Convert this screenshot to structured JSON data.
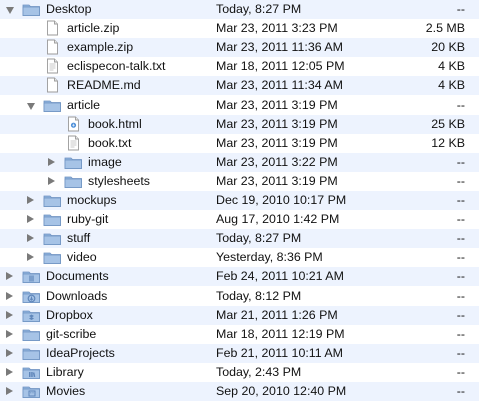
{
  "rows": [
    {
      "name": "Desktop",
      "date": "Today, 8:27 PM",
      "size": "--",
      "kind": "folder",
      "icon": "folder-icon",
      "level": 0,
      "disclosure": "open"
    },
    {
      "name": "article.zip",
      "date": "Mar 23, 2011 3:23 PM",
      "size": "2.5 MB",
      "kind": "file",
      "icon": "file-icon",
      "level": 1,
      "disclosure": "none"
    },
    {
      "name": "example.zip",
      "date": "Mar 23, 2011 11:36 AM",
      "size": "20 KB",
      "kind": "file",
      "icon": "file-icon",
      "level": 1,
      "disclosure": "none"
    },
    {
      "name": "eclispecon-talk.txt",
      "date": "Mar 18, 2011 12:05 PM",
      "size": "4 KB",
      "kind": "text",
      "icon": "text-file-icon",
      "level": 1,
      "disclosure": "none"
    },
    {
      "name": "README.md",
      "date": "Mar 23, 2011 11:34 AM",
      "size": "4 KB",
      "kind": "file",
      "icon": "file-icon",
      "level": 1,
      "disclosure": "none"
    },
    {
      "name": "article",
      "date": "Mar 23, 2011 3:19 PM",
      "size": "--",
      "kind": "folder",
      "icon": "folder-icon",
      "level": 1,
      "disclosure": "open"
    },
    {
      "name": "book.html",
      "date": "Mar 23, 2011 3:19 PM",
      "size": "25 KB",
      "kind": "html",
      "icon": "html-file-icon",
      "level": 2,
      "disclosure": "none"
    },
    {
      "name": "book.txt",
      "date": "Mar 23, 2011 3:19 PM",
      "size": "12 KB",
      "kind": "text",
      "icon": "text-file-icon",
      "level": 2,
      "disclosure": "none"
    },
    {
      "name": "image",
      "date": "Mar 23, 2011 3:22 PM",
      "size": "--",
      "kind": "folder",
      "icon": "folder-icon",
      "level": 2,
      "disclosure": "closed"
    },
    {
      "name": "stylesheets",
      "date": "Mar 23, 2011 3:19 PM",
      "size": "--",
      "kind": "folder",
      "icon": "folder-icon",
      "level": 2,
      "disclosure": "closed"
    },
    {
      "name": "mockups",
      "date": "Dec 19, 2010 10:17 PM",
      "size": "--",
      "kind": "folder",
      "icon": "folder-icon",
      "level": 1,
      "disclosure": "closed"
    },
    {
      "name": "ruby-git",
      "date": "Aug 17, 2010 1:42 PM",
      "size": "--",
      "kind": "folder",
      "icon": "folder-icon",
      "level": 1,
      "disclosure": "closed"
    },
    {
      "name": "stuff",
      "date": "Today, 8:27 PM",
      "size": "--",
      "kind": "folder",
      "icon": "folder-icon",
      "level": 1,
      "disclosure": "closed"
    },
    {
      "name": "video",
      "date": "Yesterday, 8:36 PM",
      "size": "--",
      "kind": "folder",
      "icon": "folder-icon",
      "level": 1,
      "disclosure": "closed"
    },
    {
      "name": "Documents",
      "date": "Feb 24, 2011 10:21 AM",
      "size": "--",
      "kind": "special",
      "icon": "documents-folder-icon",
      "level": 0,
      "disclosure": "closed"
    },
    {
      "name": "Downloads",
      "date": "Today, 8:12 PM",
      "size": "--",
      "kind": "special",
      "icon": "downloads-folder-icon",
      "level": 0,
      "disclosure": "closed"
    },
    {
      "name": "Dropbox",
      "date": "Mar 21, 2011 1:26 PM",
      "size": "--",
      "kind": "special",
      "icon": "dropbox-folder-icon",
      "level": 0,
      "disclosure": "closed"
    },
    {
      "name": "git-scribe",
      "date": "Mar 18, 2011 12:19 PM",
      "size": "--",
      "kind": "folder",
      "icon": "folder-icon",
      "level": 0,
      "disclosure": "closed"
    },
    {
      "name": "IdeaProjects",
      "date": "Feb 21, 2011 10:11 AM",
      "size": "--",
      "kind": "folder",
      "icon": "folder-icon",
      "level": 0,
      "disclosure": "closed"
    },
    {
      "name": "Library",
      "date": "Today, 2:43 PM",
      "size": "--",
      "kind": "special",
      "icon": "library-folder-icon",
      "level": 0,
      "disclosure": "closed"
    },
    {
      "name": "Movies",
      "date": "Sep 20, 2010 12:40 PM",
      "size": "--",
      "kind": "special",
      "icon": "movies-folder-icon",
      "level": 0,
      "disclosure": "closed"
    }
  ],
  "colors": {
    "row_alt": "#edf3fe",
    "row_plain": "#ffffff",
    "folder_body": "#a6c3e6",
    "folder_tab": "#8fb2dc",
    "folder_stroke": "#6f93c2",
    "file_stroke": "#9a9a9a",
    "disclosure": "#7a7a7a"
  }
}
